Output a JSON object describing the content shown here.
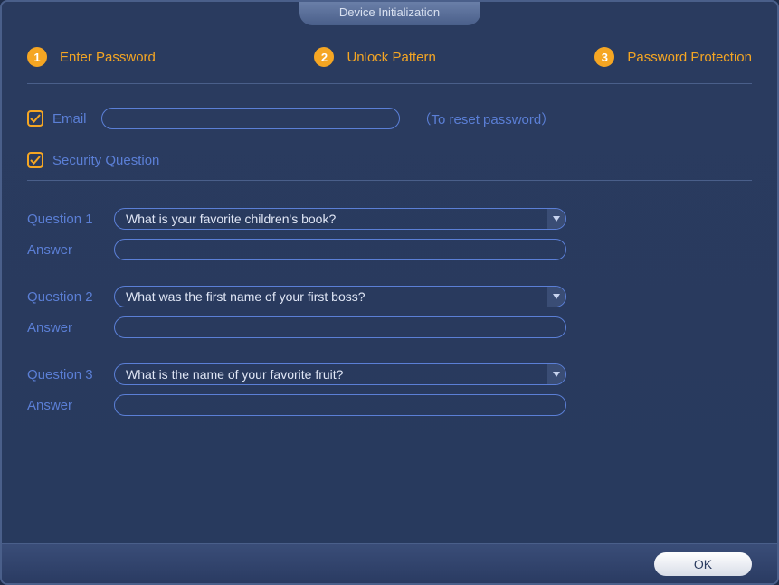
{
  "title": "Device Initialization",
  "steps": [
    {
      "num": "1",
      "label": "Enter Password"
    },
    {
      "num": "2",
      "label": "Unlock Pattern"
    },
    {
      "num": "3",
      "label": "Password Protection"
    }
  ],
  "email": {
    "label": "Email",
    "value": "",
    "hint": "（To reset password）"
  },
  "securityQuestion": {
    "label": "Security Question"
  },
  "questions": [
    {
      "qlabel": "Question 1",
      "selected": "What is your favorite children's book?",
      "alabel": "Answer",
      "avalue": ""
    },
    {
      "qlabel": "Question 2",
      "selected": "What was the first name of your first boss?",
      "alabel": "Answer",
      "avalue": ""
    },
    {
      "qlabel": "Question 3",
      "selected": "What is the name of your favorite fruit?",
      "alabel": "Answer",
      "avalue": ""
    }
  ],
  "okLabel": "OK"
}
